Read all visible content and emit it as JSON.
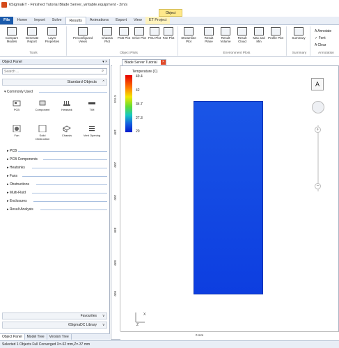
{
  "window": {
    "title": "6SigmaET - Finished Tutorial Blade Server_writable.equipment - 2m/s"
  },
  "context_group": "Object",
  "tabs": [
    "File",
    "Home",
    "Import",
    "Solve",
    "Results",
    "Animations",
    "Export",
    "View",
    "ET Project"
  ],
  "ribbon": {
    "buttons": [
      {
        "label": "Compare Models"
      },
      {
        "label": "Generate Report"
      },
      {
        "label": "Layer Properties"
      },
      {
        "label": "Preconfigured Views"
      },
      {
        "label": "Chassis Plot"
      },
      {
        "label": "PCB Plot"
      },
      {
        "label": "Drive Plot"
      },
      {
        "label": "PSU Plot"
      },
      {
        "label": "Fan Plot"
      },
      {
        "label": "Streamline Plot"
      },
      {
        "label": "Result Plane"
      },
      {
        "label": "Result Volume"
      },
      {
        "label": "Result Cloud"
      },
      {
        "label": "Max and Min"
      },
      {
        "label": "Profile Plot"
      },
      {
        "label": "Summary"
      }
    ],
    "groups": [
      "Tools",
      "Object Plots",
      "Environment Plots",
      "Summary",
      "Annotation"
    ],
    "annotation_items": [
      "Annotate",
      "Font",
      "Clear"
    ]
  },
  "object_panel": {
    "title": "Object Panel",
    "controls": "▾ ×",
    "search_placeholder": "Search ...",
    "standard_objects": "Standard Objects",
    "commonly_used": "Commonly Used",
    "items": [
      {
        "label": "PCB"
      },
      {
        "label": "Component"
      },
      {
        "label": "Heatsink"
      },
      {
        "label": "TIM"
      },
      {
        "label": "Fan"
      },
      {
        "label": "Solid Obstruction"
      },
      {
        "label": "Chassis"
      },
      {
        "label": "Vent Opening"
      }
    ],
    "categories": [
      "PCB",
      "PCB Components",
      "Heatsinks",
      "Fans",
      "Obstructions",
      "Multi-Fluid",
      "Enclosures",
      "Result Analysis"
    ],
    "favourites": "Favourites",
    "library": "6SigmaDC Library"
  },
  "bottom_tabs": [
    "Object Panel",
    "Model Tree",
    "Version Tree"
  ],
  "document": {
    "tab_title": "Blade Server Tutorial"
  },
  "legend": {
    "title": "Temperature (C)",
    "labels": [
      "49.4",
      "42",
      "34.7",
      "27.3",
      "20"
    ]
  },
  "ruler": {
    "vertical": [
      "0 mm",
      "100",
      "200",
      "300",
      "400",
      "500",
      "600"
    ],
    "horizontal": "0 mm"
  },
  "axis_labels": {
    "x": "X",
    "z": "Z"
  },
  "nav": {
    "cube_face": "A",
    "zoom_in": "+",
    "zoom_out": "−"
  },
  "status": "Selected 1 Objects  Full Converged  X=-62 mm,Z=-37 mm"
}
